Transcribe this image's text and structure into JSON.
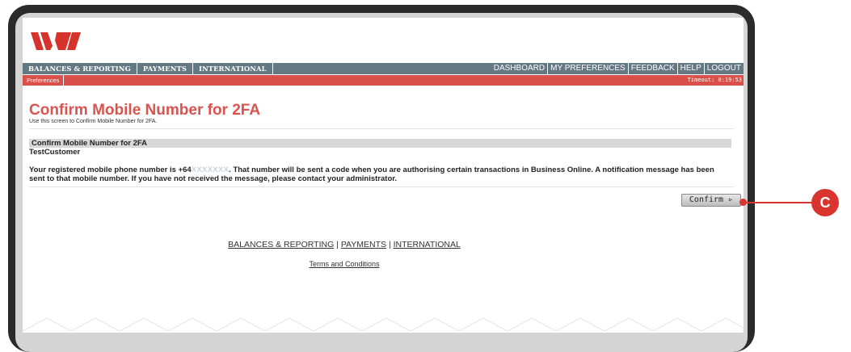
{
  "nav": {
    "tabs": [
      "BALANCES & REPORTING",
      "PAYMENTS",
      "INTERNATIONAL"
    ],
    "utility": [
      "DASHBOARD",
      "MY PREFERENCES",
      "FEEDBACK",
      "HELP",
      "LOGOUT"
    ]
  },
  "subnav": {
    "item": "Preferences",
    "timeout": "Timeout: 0:19:53"
  },
  "page": {
    "title": "Confirm Mobile Number for 2FA",
    "subtitle": "Use this screen to Confirm Mobile Number for 2FA."
  },
  "section": {
    "header": "Confirm Mobile Number for 2FA",
    "customer": "TestCustomer",
    "message_before": "Your registered mobile phone number is +64",
    "masked_number": "XXXXXXX",
    "message_after": ". That number will be sent a code when you are authorising certain transactions in Business Online. A notification message has been sent to that mobile number. If you have not received the message, please contact your administrator."
  },
  "actions": {
    "confirm_label": "Confirm ▹"
  },
  "footer": {
    "links": [
      "BALANCES & REPORTING",
      "PAYMENTS",
      "INTERNATIONAL"
    ],
    "terms": "Terms and Conditions"
  },
  "annotation": {
    "label": "C"
  },
  "colors": {
    "brand_red": "#d9534f",
    "nav_gray": "#647883",
    "subnav_red": "#da4f49"
  }
}
